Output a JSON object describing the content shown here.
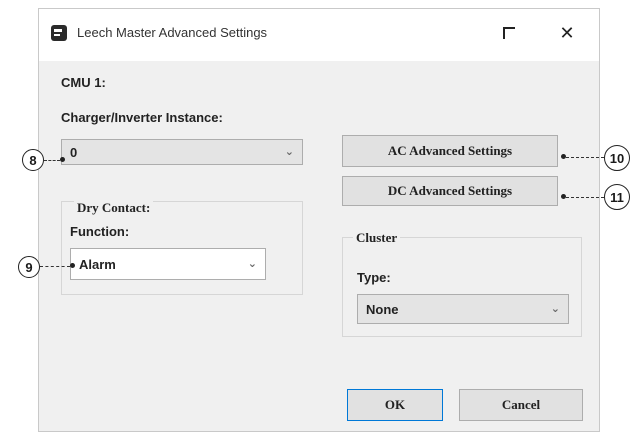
{
  "window": {
    "title": "Leech Master Advanced Settings",
    "maximize_glyph": "maximize-icon",
    "close_glyph": "✕"
  },
  "cmu_label": "CMU 1:",
  "charger": {
    "label": "Charger/Inverter Instance:",
    "value": "0",
    "chevron": "⌄"
  },
  "dry_contact": {
    "title": "Dry Contact:",
    "function_label": "Function:",
    "value": "Alarm",
    "chevron": "⌄"
  },
  "buttons": {
    "ac_advanced": "AC Advanced Settings",
    "dc_advanced": "DC Advanced Settings",
    "ok": "OK",
    "cancel": "Cancel"
  },
  "cluster": {
    "title": "Cluster",
    "type_label": "Type:",
    "value": "None",
    "chevron": "⌄"
  },
  "callouts": {
    "c8": "8",
    "c9": "9",
    "c10": "10",
    "c11": "11"
  }
}
